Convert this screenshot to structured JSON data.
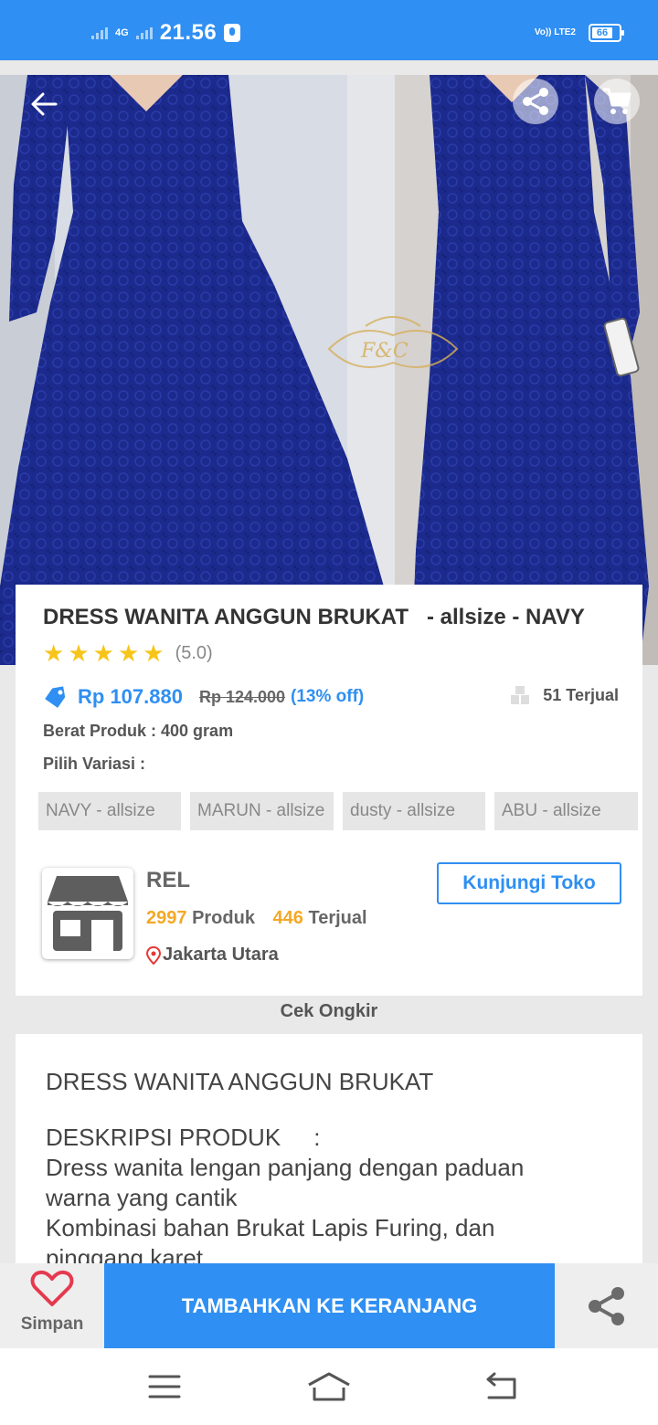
{
  "status_bar": {
    "network": "4G",
    "time": "21.56",
    "volte": "Vo)) LTE2",
    "battery": "66"
  },
  "product": {
    "title": "DRESS WANITA ANGGUN BRUKAT   - allsize - NAVY",
    "rating": "(5.0)",
    "stars": 5,
    "price": "Rp 107.880",
    "old_price": "Rp 124.000",
    "discount": "(13% off)",
    "sold": "51 Terjual",
    "weight": "Berat Produk : 400 gram",
    "variant_label": "Pilih Variasi :",
    "variants": [
      "NAVY - allsize",
      "MARUN - allsize",
      "dusty - allsize",
      "ABU - allsize"
    ],
    "watermark": "F&C"
  },
  "shop": {
    "name": "REL",
    "products_count": "2997",
    "products_label": "Produk",
    "sold_count": "446",
    "sold_label": "Terjual",
    "location": "Jakarta Utara",
    "visit_label": "Kunjungi Toko"
  },
  "shipping_label": "Cek Ongkir",
  "description": {
    "heading": "DRESS WANITA ANGGUN BRUKAT",
    "section_title": "DESKRIPSI PRODUK     :",
    "line1": "Dress wanita lengan panjang dengan paduan warna yang cantik",
    "line2": "Kombinasi bahan Brukat Lapis Furing, dan pinggang karet"
  },
  "actions": {
    "save_label": "Simpan",
    "add_to_cart_label": "TAMBAHKAN KE KERANJANG"
  },
  "icons": [
    "back-arrow-icon",
    "share-icon",
    "cart-icon",
    "star-icon",
    "price-tag-icon",
    "box-icon",
    "store-icon",
    "location-pin-icon",
    "heart-icon",
    "menu-icon",
    "home-icon",
    "back-icon"
  ],
  "colors": {
    "primary": "#2f8ff2",
    "star": "#f7c51a",
    "accent_number": "#f4a824",
    "dress": "#1b2a8c"
  }
}
